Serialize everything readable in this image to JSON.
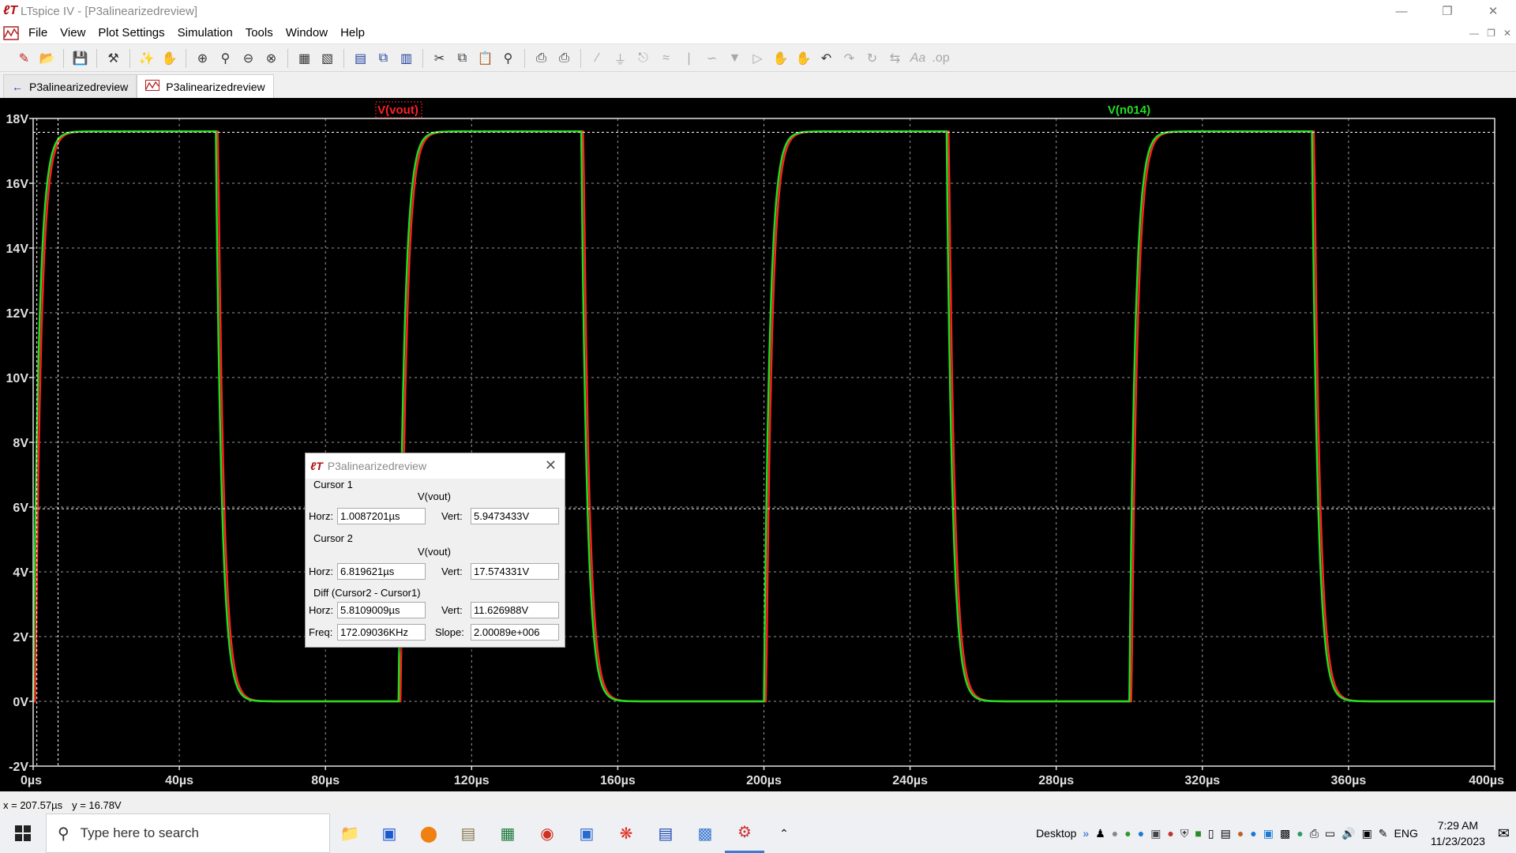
{
  "window": {
    "title": "LTspice IV - [P3alinearizedreview]",
    "app_logo": "ltspice-logo-icon",
    "controls": [
      "minimize-icon",
      "restore-icon",
      "close-icon"
    ]
  },
  "menu": {
    "items": [
      "File",
      "View",
      "Plot Settings",
      "Simulation",
      "Tools",
      "Window",
      "Help"
    ]
  },
  "toolbar": {
    "buttons": [
      "new-schematic-icon",
      "open-icon",
      "save-icon",
      "control-panel-icon",
      "run-icon",
      "halt-icon",
      "zoom-in-icon",
      "zoom-area-icon",
      "zoom-out-icon",
      "zoom-fit-icon",
      "autorange-icon",
      "mark-unused-icon",
      "tile-horizontal-icon",
      "cascade-icon",
      "tile-vertical-icon",
      "cut-icon",
      "copy-icon",
      "paste-icon",
      "find-icon",
      "print-preview-icon",
      "print-icon",
      "wire-icon",
      "ground-icon",
      "label-icon",
      "resistor-icon",
      "capacitor-icon",
      "inductor-icon",
      "diode-icon",
      "component-icon",
      "move-icon",
      "drag-icon",
      "undo-icon",
      "redo-icon",
      "rotate-icon",
      "mirror-icon",
      "text-icon",
      "spice-directive-icon"
    ]
  },
  "tabs": [
    {
      "label": "P3alinearizedreview",
      "icon": "schematic-icon",
      "active": false
    },
    {
      "label": "P3alinearizedreview",
      "icon": "waveform-icon",
      "active": true
    }
  ],
  "plot": {
    "colors": {
      "vout": "#ff2020",
      "n014": "#22dd22",
      "axis": "#e0e0e0",
      "grid": "#9a9a9a"
    },
    "traces": [
      {
        "label": "V(vout)",
        "color": "#ff2020"
      },
      {
        "label": "V(n014)",
        "color": "#22dd22"
      }
    ],
    "y_ticks": [
      "18V",
      "16V",
      "14V",
      "12V",
      "10V",
      "8V",
      "6V",
      "4V",
      "2V",
      "0V",
      "-2V"
    ],
    "x_ticks": [
      "0µs",
      "40µs",
      "80µs",
      "120µs",
      "160µs",
      "200µs",
      "240µs",
      "280µs",
      "320µs",
      "360µs",
      "400µs"
    ]
  },
  "chart_data": {
    "type": "line",
    "xlabel": "",
    "ylabel": "",
    "xlim": [
      0,
      400
    ],
    "ylim": [
      -2,
      18
    ],
    "x_unit": "µs",
    "y_unit": "V",
    "grid": true,
    "legend": "top",
    "series": [
      {
        "name": "V(vout)",
        "kind": "square",
        "period": 100,
        "high": 17.6,
        "low": 0,
        "rise_at": [
          0,
          100,
          200,
          300
        ],
        "fall_at": [
          50,
          150,
          250,
          350
        ],
        "lag": 0.6
      },
      {
        "name": "V(n014)",
        "kind": "square",
        "period": 100,
        "high": 17.6,
        "low": 0,
        "rise_at": [
          0,
          100,
          200,
          300
        ],
        "fall_at": [
          50,
          150,
          250,
          350
        ],
        "lag": 0
      }
    ]
  },
  "cursor_dialog": {
    "title": "P3alinearizedreview",
    "cursor1": {
      "heading": "Cursor 1",
      "trace": "V(vout)",
      "horz_label": "Horz:",
      "horz": "1.0087201µs",
      "vert_label": "Vert:",
      "vert": "5.9473433V"
    },
    "cursor2": {
      "heading": "Cursor 2",
      "trace": "V(vout)",
      "horz_label": "Horz:",
      "horz": "6.819621µs",
      "vert_label": "Vert:",
      "vert": "17.574331V"
    },
    "diff": {
      "heading": "Diff (Cursor2 - Cursor1)",
      "horz_label": "Horz:",
      "horz": "5.8109009µs",
      "vert_label": "Vert:",
      "vert": "11.626988V",
      "freq_label": "Freq:",
      "freq": "172.09036KHz",
      "slope_label": "Slope:",
      "slope": "2.00089e+006"
    }
  },
  "status": {
    "x": "x = 207.57µs",
    "y": "y = 16.78V"
  },
  "taskbar": {
    "search_placeholder": "Type here to search",
    "apps": [
      "file-explorer-icon",
      "store-icon",
      "edge-icon",
      "notepad-icon",
      "excel-icon",
      "chrome-icon",
      "remote-desktop-icon",
      "snip-icon",
      "word-icon",
      "ltspice-taskbar-icon",
      "ltspice-wave-icon"
    ],
    "desktop_label": "Desktop",
    "language": "ENG",
    "time": "7:29 AM",
    "date": "11/23/2023"
  }
}
